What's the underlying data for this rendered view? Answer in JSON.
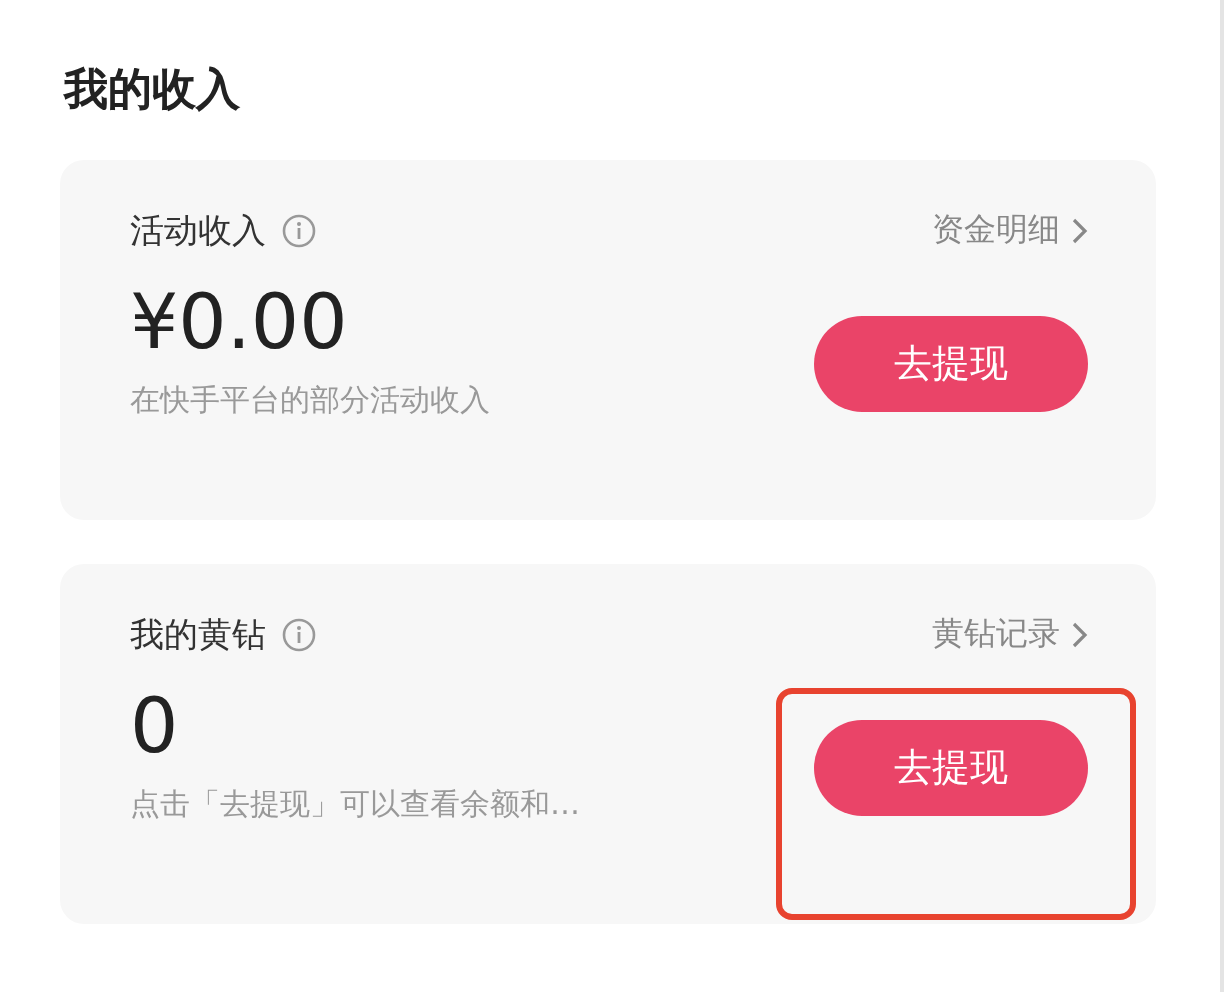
{
  "title": "我的收入",
  "cards": [
    {
      "label": "活动收入",
      "link": "资金明细",
      "amount": "¥0.00",
      "description": "在快手平台的部分活动收入",
      "button": "去提现",
      "highlighted": false
    },
    {
      "label": "我的黄钻",
      "link": "黄钻记录",
      "amount": "0",
      "description": "点击「去提现」可以查看余额和…",
      "button": "去提现",
      "highlighted": true
    }
  ]
}
